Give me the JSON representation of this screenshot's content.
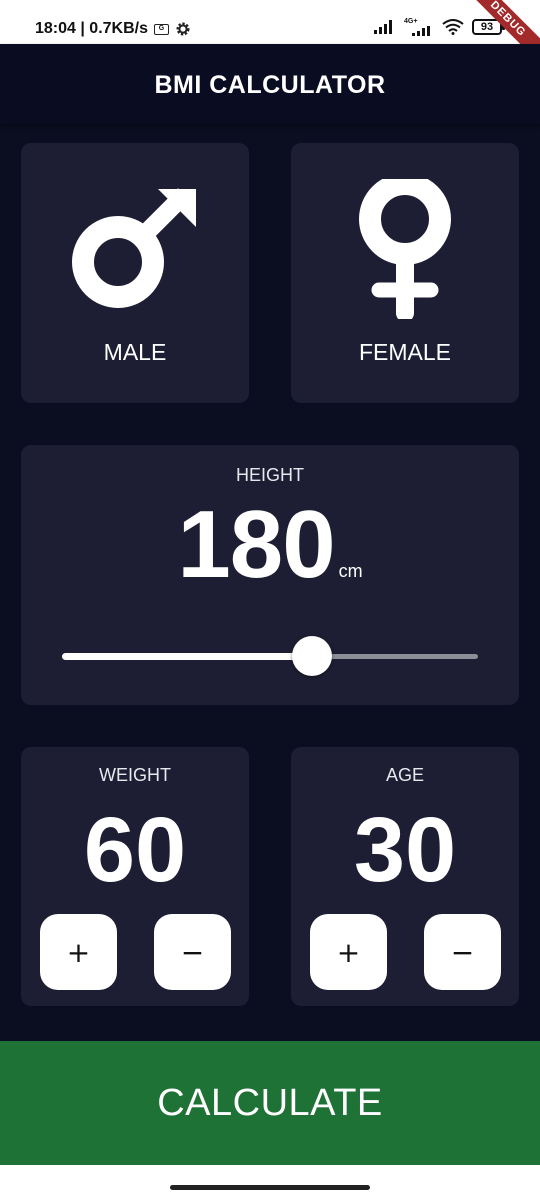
{
  "status_bar": {
    "time_speed": "18:04 | 0.7KB/s",
    "network_label": "4G+",
    "battery": "93",
    "debug": "DEBUG"
  },
  "app_bar": {
    "title": "BMI CALCULATOR"
  },
  "gender": {
    "male_label": "MALE",
    "female_label": "FEMALE"
  },
  "height": {
    "label": "HEIGHT",
    "value": "180",
    "unit": "cm",
    "slider_fraction": 0.6
  },
  "weight": {
    "label": "WEIGHT",
    "value": "60",
    "plus": "+",
    "minus": "−"
  },
  "age": {
    "label": "AGE",
    "value": "30",
    "plus": "+",
    "minus": "−"
  },
  "calculate": {
    "label": "CALCULATE"
  },
  "colors": {
    "background": "#0b0e21",
    "card": "#1d1e33",
    "accent_green": "#1f7235"
  }
}
